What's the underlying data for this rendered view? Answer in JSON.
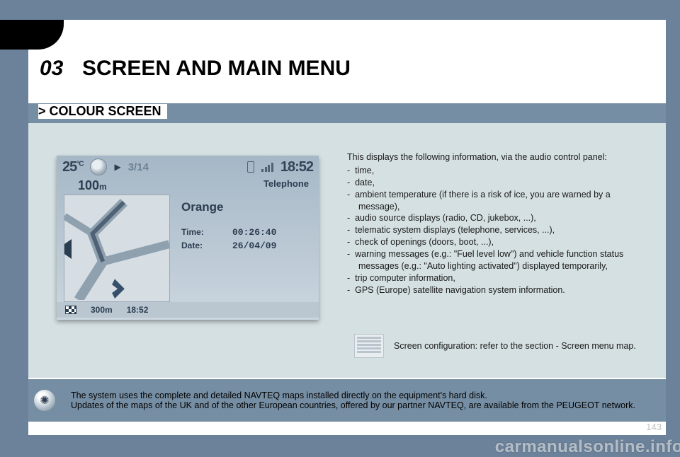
{
  "chapter": {
    "number": "03",
    "title": "SCREEN AND MAIN MENU"
  },
  "section_heading": "> COLOUR SCREEN",
  "nav_screen": {
    "temperature": "25",
    "temperature_unit": "°C",
    "play_symbol": "▶",
    "track": "3/14",
    "clock": "18:52",
    "distance": "100",
    "distance_unit": "m",
    "telephone_label": "Telephone",
    "carrier": "Orange",
    "time_label": "Time:",
    "time_value": "00:26:40",
    "date_label": "Date:",
    "date_value": "26/04/09",
    "eta_distance": "300m",
    "eta_time": "18:52"
  },
  "info": {
    "intro": "This displays the following information, via the audio control panel:",
    "items": [
      "time,",
      "date,",
      "ambient temperature (if there is a risk of ice, you are warned by a message),",
      "audio source displays (radio, CD, jukebox, ...),",
      "telematic system displays (telephone, services, ...),",
      "check of openings (doors, boot, ...),",
      "warning messages (e.g.: \"Fuel level low\") and vehicle function status messages (e.g.: \"Auto lighting activated\") displayed temporarily,",
      "trip computer information,",
      "GPS (Europe) satellite navigation system information."
    ]
  },
  "config_note": "Screen configuration: refer to the section - Screen menu map.",
  "footer_tip": {
    "line1": "The system uses the complete and detailed NAVTEQ maps installed directly on the equipment's hard disk.",
    "line2": "Updates of the maps of the UK and of the other European countries, offered by our partner NAVTEQ, are available from the PEUGEOT network."
  },
  "page_number": "143",
  "watermark": "carmanualsonline.info"
}
